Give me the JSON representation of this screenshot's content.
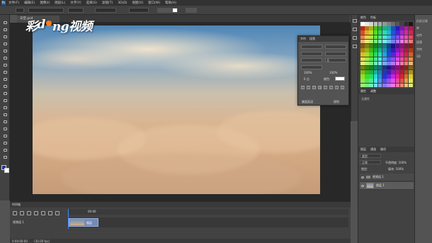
{
  "menu": {
    "items": [
      "文件(F)",
      "编辑(E)",
      "图像(I)",
      "图层(L)",
      "文字(Y)",
      "选择(S)",
      "滤镜(T)",
      "3D(D)",
      "视图(V)",
      "窗口(W)",
      "帮助(H)"
    ]
  },
  "document": {
    "tab_label": "天空.psd"
  },
  "watermark": {
    "text_before": "彩",
    "text_after": "ng视频",
    "latin": "d"
  },
  "character_panel": {
    "tabs": [
      "字符",
      "段落"
    ],
    "tracking_value": "0",
    "scale_v": "100%",
    "scale_h": "100%",
    "baseline": "0 点",
    "color_label": "颜色:",
    "lang": "美国英语",
    "aa": "锐利"
  },
  "right_panels": {
    "top_tabs": [
      "颜色",
      "色板"
    ],
    "mid_tabs": [
      "属性",
      "调整"
    ],
    "mid_note": "无属性",
    "layers_tabs": [
      "图层",
      "通道",
      "路径"
    ],
    "kind_label": "类型",
    "mode_label": "正常",
    "opacity_label": "不透明度: 100%",
    "lock_label": "锁定:",
    "fill_label": "填充: 100%",
    "layers": [
      {
        "name": "视频组 1",
        "type": "group"
      },
      {
        "name": "图层 1",
        "type": "layer"
      }
    ]
  },
  "far_right": {
    "items": [
      "历史记录",
      "库",
      "动作",
      "段落",
      "字符",
      "3D"
    ]
  },
  "timeline": {
    "title": "时间轴",
    "track_label": "视频组 1",
    "clip_label": "图层",
    "time_label": "00:00",
    "fps": "(30.00 fps)",
    "current_time": "0:00:00:00"
  },
  "colors": {
    "ui_dark": "#323232",
    "ui_panel": "#424242",
    "accent": "#3e8bff",
    "watermark_dot": "#ff7a1a"
  },
  "icons": [
    "move-icon",
    "marquee-icon",
    "lasso-icon",
    "magic-wand-icon",
    "crop-icon",
    "eyedropper-icon",
    "healing-icon",
    "brush-icon",
    "stamp-icon",
    "history-brush-icon",
    "eraser-icon",
    "gradient-icon",
    "blur-icon",
    "dodge-icon",
    "pen-icon",
    "type-icon",
    "path-select-icon",
    "shape-icon",
    "hand-icon",
    "zoom-icon"
  ]
}
